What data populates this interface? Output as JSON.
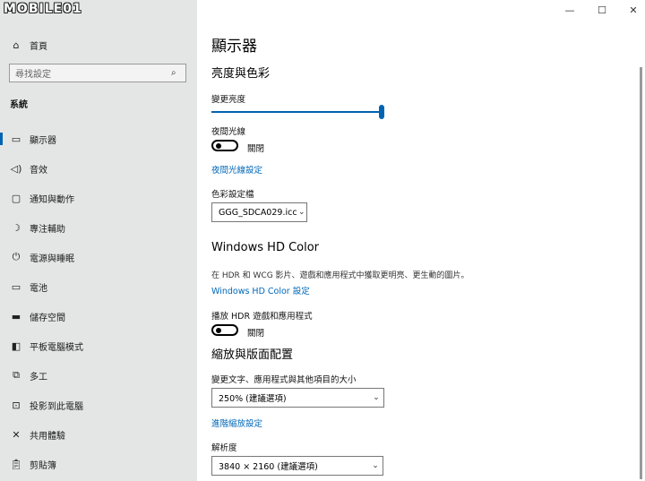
{
  "window": {
    "logo": "MOBILE01",
    "controls": {
      "minimize": "—",
      "maximize": "☐",
      "close": "✕"
    }
  },
  "sidebar": {
    "home": "首頁",
    "search_placeholder": "尋找設定",
    "section": "系統",
    "items": [
      {
        "label": "顯示器",
        "icon": "monitor-icon"
      },
      {
        "label": "音效",
        "icon": "speaker-icon"
      },
      {
        "label": "通知與動作",
        "icon": "notification-icon"
      },
      {
        "label": "專注輔助",
        "icon": "moon-icon"
      },
      {
        "label": "電源與睡眠",
        "icon": "power-icon"
      },
      {
        "label": "電池",
        "icon": "battery-icon"
      },
      {
        "label": "儲存空間",
        "icon": "storage-icon"
      },
      {
        "label": "平板電腦模式",
        "icon": "tablet-icon"
      },
      {
        "label": "多工",
        "icon": "multitask-icon"
      },
      {
        "label": "投影到此電腦",
        "icon": "project-icon"
      },
      {
        "label": "共用體驗",
        "icon": "shared-icon"
      },
      {
        "label": "剪貼簿",
        "icon": "clipboard-icon"
      }
    ],
    "active_index": 0,
    "accent": "#0063b1"
  },
  "main": {
    "title": "顯示器",
    "brightness": {
      "heading": "亮度與色彩",
      "change_label": "變更亮度",
      "level_percent": 100,
      "night_light_label": "夜間光線",
      "night_light_state": "關閉",
      "night_light_link": "夜間光線設定",
      "profile_label": "色彩設定檔",
      "profile_value": "GGG_SDCA029.icc"
    },
    "hdr": {
      "heading": "Windows HD Color",
      "description": "在 HDR 和 WCG 影片、遊戲和應用程式中獲取更明亮、更生動的圖片。",
      "link": "Windows HD Color 設定",
      "play_label": "播放 HDR 遊戲和應用程式",
      "play_state": "關閉"
    },
    "scale": {
      "heading": "縮放與版面配置",
      "size_label": "變更文字、應用程式與其他項目的大小",
      "size_value": "250% (建議選項)",
      "advanced_link": "進階縮放設定",
      "resolution_label": "解析度",
      "resolution_value": "3840 × 2160 (建議選項)"
    }
  }
}
